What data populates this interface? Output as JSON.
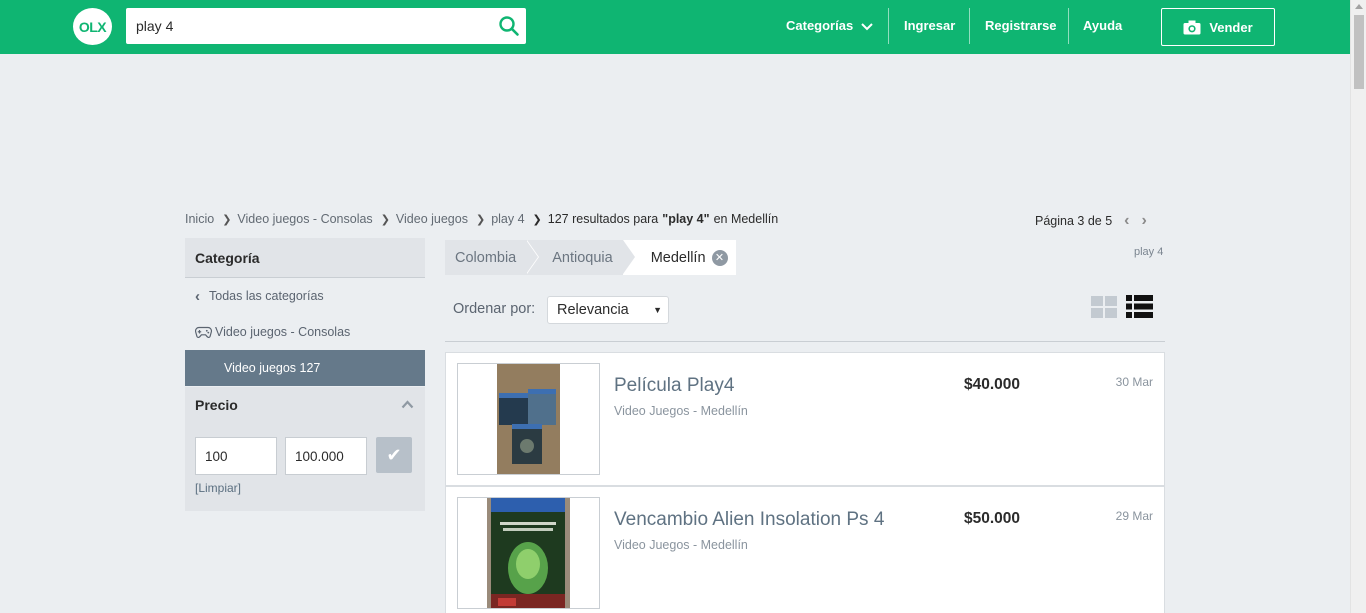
{
  "header": {
    "logo_text": "OLX",
    "search_value": "play 4",
    "nav": {
      "categorias": "Categorías",
      "ingresar": "Ingresar",
      "registrarse": "Registrarse",
      "ayuda": "Ayuda",
      "vender": "Vender"
    },
    "brand_color": "#0fb572"
  },
  "breadcrumb": {
    "items": [
      "Inicio",
      "Video juegos - Consolas",
      "Video juegos",
      "play 4"
    ],
    "results_prefix": "127 resultados para",
    "results_query": "\"play 4\"",
    "results_suffix": "en Medellín"
  },
  "pager": {
    "label": "Página 3 de 5"
  },
  "sidebar": {
    "category_title": "Categoría",
    "all_categories": "Todas las categorías",
    "parent_category": "Video juegos - Consolas",
    "active_category": "Video juegos 127",
    "price_title": "Precio",
    "price_min": "100",
    "price_max": "100.000",
    "clear": "[Limpiar]"
  },
  "location": {
    "tabs": [
      "Colombia",
      "Antioquia",
      "Medellín"
    ],
    "search_tag": "play 4"
  },
  "sort": {
    "label": "Ordenar por:",
    "selected": "Relevancia"
  },
  "listings": [
    {
      "title": "Película Play4",
      "subtitle": "Video Juegos - Medellín",
      "price": "$40.000",
      "date": "30 Mar"
    },
    {
      "title": "Vencambio Alien Insolation Ps 4",
      "subtitle": "Video Juegos - Medellín",
      "price": "$50.000",
      "date": "29 Mar"
    }
  ]
}
